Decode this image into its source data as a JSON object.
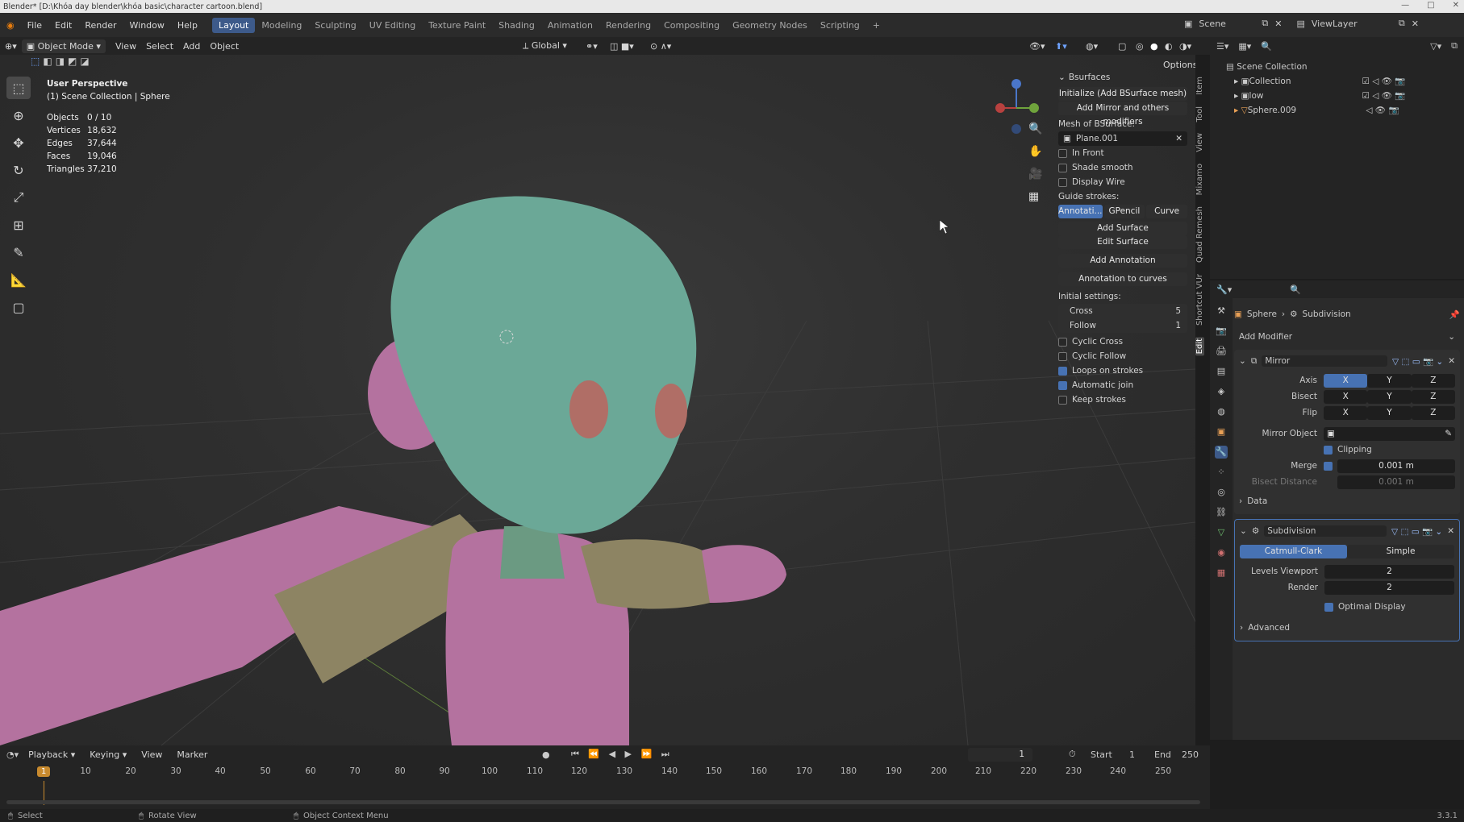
{
  "title_bar": {
    "text": "Blender* [D:\\Khóa day blender\\khóa basic\\character cartoon.blend]"
  },
  "menu": [
    "File",
    "Edit",
    "Render",
    "Window",
    "Help"
  ],
  "workspaces": [
    {
      "label": "Layout",
      "active": true
    },
    {
      "label": "Modeling",
      "active": false
    },
    {
      "label": "Sculpting",
      "active": false
    },
    {
      "label": "UV Editing",
      "active": false
    },
    {
      "label": "Texture Paint",
      "active": false
    },
    {
      "label": "Shading",
      "active": false
    },
    {
      "label": "Animation",
      "active": false
    },
    {
      "label": "Rendering",
      "active": false
    },
    {
      "label": "Compositing",
      "active": false
    },
    {
      "label": "Geometry Nodes",
      "active": false
    },
    {
      "label": "Scripting",
      "active": false
    }
  ],
  "scene": {
    "label": "Scene",
    "view_layer": "ViewLayer"
  },
  "viewport_header": {
    "mode": "Object Mode",
    "view": "View",
    "select": "Select",
    "add": "Add",
    "object": "Object",
    "orientation": "Global",
    "options": "Options"
  },
  "overlay_text": {
    "perspective": "User Perspective",
    "collection": "(1) Scene Collection | Sphere",
    "stats": [
      {
        "k": "Objects",
        "v": "0 / 10"
      },
      {
        "k": "Vertices",
        "v": "18,632"
      },
      {
        "k": "Edges",
        "v": "37,644"
      },
      {
        "k": "Faces",
        "v": "19,046"
      },
      {
        "k": "Triangles",
        "v": "37,210"
      }
    ]
  },
  "npanel": {
    "header": "Bsurfaces",
    "init_btn": "Initialize (Add BSurface mesh)",
    "mirror_btn": "Add Mirror and others modifiers",
    "mesh_label": "Mesh of BSurface:",
    "mesh_value": "Plane.001",
    "in_front": "In Front",
    "shade_smooth": "Shade smooth",
    "display_wire": "Display Wire",
    "guide_label": "Guide strokes:",
    "guide_tabs": [
      "Annotati...",
      "GPencil",
      "Curve"
    ],
    "add_surface": "Add Surface",
    "edit_surface": "Edit Surface",
    "add_annotation": "Add Annotation",
    "annotation_curves": "Annotation to curves",
    "initial_label": "Initial settings:",
    "cross_label": "Cross",
    "cross_value": "5",
    "follow_label": "Follow",
    "follow_value": "1",
    "cyclic_cross": "Cyclic Cross",
    "cyclic_follow": "Cyclic Follow",
    "loops_on_strokes": "Loops on strokes",
    "automatic_join": "Automatic join",
    "keep_strokes": "Keep strokes"
  },
  "side_tabs": [
    "Item",
    "Tool",
    "View",
    "Mixamo",
    "Quad Remesh",
    "Shortcut VUr",
    "Edit"
  ],
  "outliner": {
    "root": "Scene Collection",
    "items": [
      {
        "label": "Collection"
      },
      {
        "label": "low"
      },
      {
        "label": "Sphere.009"
      }
    ]
  },
  "properties": {
    "breadcrumb_object": "Sphere",
    "breadcrumb_modifier": "Subdivision",
    "add_modifier": "Add Modifier",
    "mirror": {
      "name": "Mirror",
      "axis_label": "Axis",
      "bisect_label": "Bisect",
      "flip_label": "Flip",
      "x": "X",
      "y": "Y",
      "z": "Z",
      "mirror_object": "Mirror Object",
      "clipping": "Clipping",
      "merge_label": "Merge",
      "merge_value": "0.001 m",
      "bisect_distance": "Bisect Distance",
      "bisect_value": "0.001 m",
      "data": "Data"
    },
    "subdivision": {
      "name": "Subdivision",
      "catmull": "Catmull-Clark",
      "simple": "Simple",
      "levels_viewport": "Levels Viewport",
      "levels_value": "2",
      "render_label": "Render",
      "render_value": "2",
      "optimal_display": "Optimal Display",
      "advanced": "Advanced"
    }
  },
  "timeline": {
    "playback": "Playback",
    "keying": "Keying",
    "view": "View",
    "marker": "Marker",
    "current_frame": "1",
    "start_label": "Start",
    "start": "1",
    "end_label": "End",
    "end": "250",
    "ticks": [
      "10",
      "20",
      "30",
      "40",
      "50",
      "60",
      "70",
      "80",
      "90",
      "100",
      "110",
      "120",
      "130",
      "140",
      "150",
      "160",
      "170",
      "180",
      "190",
      "200",
      "210",
      "220",
      "230",
      "240",
      "250"
    ],
    "playhead": "1"
  },
  "status": {
    "select": "Select",
    "rotate": "Rotate View",
    "context": "Object Context Menu",
    "version": "3.3.1"
  },
  "colors": {
    "accent": "#4772b3",
    "head": "#6ba897",
    "limb_pink": "#b4729f",
    "limb_olive": "#8d8463"
  }
}
